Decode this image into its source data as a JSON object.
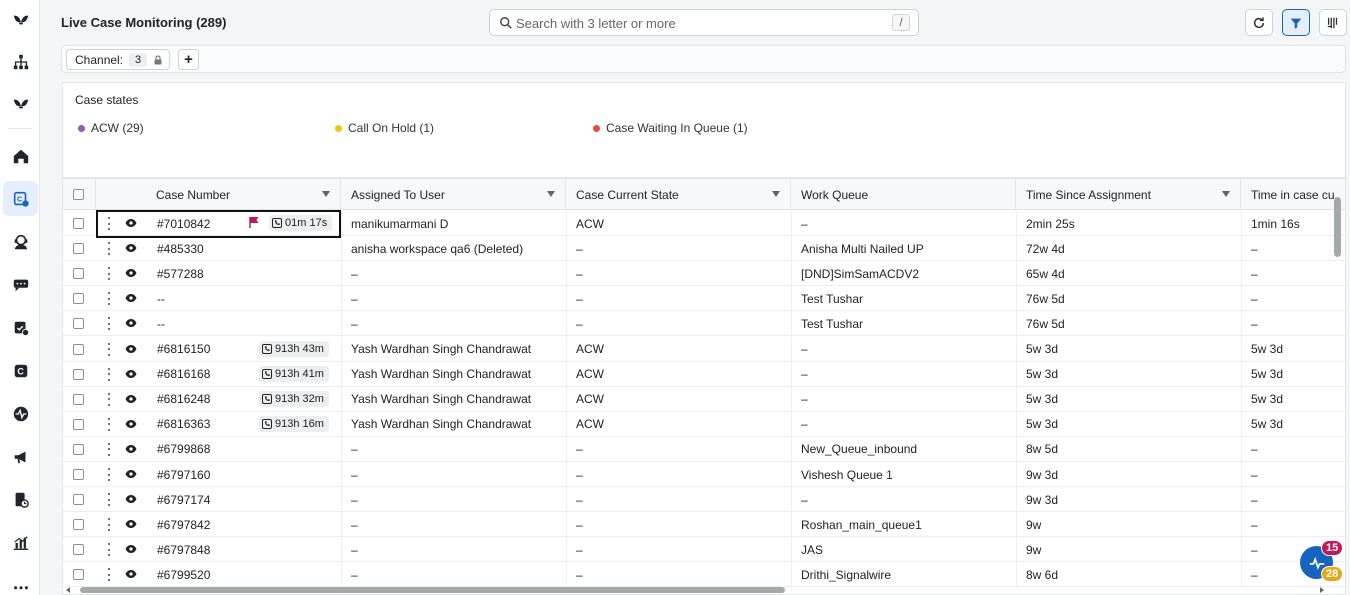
{
  "header": {
    "title": "Live Case Monitoring (289)",
    "search_placeholder": "Search with 3 letter or more",
    "search_shortcut": "/"
  },
  "filter": {
    "channel_label": "Channel:",
    "channel_count": "3",
    "add_label": "+"
  },
  "case_states": {
    "title": "Case states",
    "items": [
      {
        "label": "ACW (29)",
        "color": "#9b59b6"
      },
      {
        "label": "Call On Hold (1)",
        "color": "#f1c40f"
      },
      {
        "label": "Case Waiting In Queue (1)",
        "color": "#e74c3c"
      }
    ]
  },
  "table": {
    "columns": [
      "Case Number",
      "Assigned To User",
      "Case Current State",
      "Work Queue",
      "Time Since Assignment",
      "Time in case cu"
    ],
    "rows": [
      {
        "case": "#7010842",
        "badge": "01m 17s",
        "flag": true,
        "user": "manikumarmani D",
        "state": "ACW",
        "queue": "–",
        "since": "2min 25s",
        "incase": "1min 16s"
      },
      {
        "case": "#485330",
        "badge": "",
        "flag": false,
        "user": "anisha workspace qa6 (Deleted)",
        "state": "–",
        "queue": "Anisha Multi Nailed UP",
        "since": "72w 4d",
        "incase": "–"
      },
      {
        "case": "#577288",
        "badge": "",
        "flag": false,
        "user": "–",
        "state": "–",
        "queue": "[DND]SimSamACDV2",
        "since": "65w 4d",
        "incase": "–"
      },
      {
        "case": "--",
        "badge": "",
        "flag": false,
        "user": "–",
        "state": "–",
        "queue": "Test Tushar",
        "since": "76w 5d",
        "incase": "–"
      },
      {
        "case": "--",
        "badge": "",
        "flag": false,
        "user": "–",
        "state": "–",
        "queue": "Test Tushar",
        "since": "76w 5d",
        "incase": "–"
      },
      {
        "case": "#6816150",
        "badge": "913h 43m",
        "flag": false,
        "user": "Yash Wardhan Singh Chandrawat",
        "state": "ACW",
        "queue": "–",
        "since": "5w 3d",
        "incase": "5w 3d"
      },
      {
        "case": "#6816168",
        "badge": "913h 41m",
        "flag": false,
        "user": "Yash Wardhan Singh Chandrawat",
        "state": "ACW",
        "queue": "–",
        "since": "5w 3d",
        "incase": "5w 3d"
      },
      {
        "case": "#6816248",
        "badge": "913h 32m",
        "flag": false,
        "user": "Yash Wardhan Singh Chandrawat",
        "state": "ACW",
        "queue": "–",
        "since": "5w 3d",
        "incase": "5w 3d"
      },
      {
        "case": "#6816363",
        "badge": "913h 16m",
        "flag": false,
        "user": "Yash Wardhan Singh Chandrawat",
        "state": "ACW",
        "queue": "–",
        "since": "5w 3d",
        "incase": "5w 3d"
      },
      {
        "case": "#6799868",
        "badge": "",
        "flag": false,
        "user": "–",
        "state": "–",
        "queue": "New_Queue_inbound",
        "since": "8w 5d",
        "incase": "–"
      },
      {
        "case": "#6797160",
        "badge": "",
        "flag": false,
        "user": "–",
        "state": "–",
        "queue": "Vishesh Queue 1",
        "since": "9w 3d",
        "incase": "–"
      },
      {
        "case": "#6797174",
        "badge": "",
        "flag": false,
        "user": "–",
        "state": "–",
        "queue": "–",
        "since": "9w 3d",
        "incase": "–"
      },
      {
        "case": "#6797842",
        "badge": "",
        "flag": false,
        "user": "–",
        "state": "–",
        "queue": "Roshan_main_queue1",
        "since": "9w",
        "incase": "–"
      },
      {
        "case": "#6797848",
        "badge": "",
        "flag": false,
        "user": "–",
        "state": "–",
        "queue": "JAS",
        "since": "9w",
        "incase": "–"
      },
      {
        "case": "#6799520",
        "badge": "",
        "flag": false,
        "user": "–",
        "state": "–",
        "queue": "Drithi_Signalwire",
        "since": "8w 6d",
        "incase": "–"
      }
    ]
  },
  "widget": {
    "badge_top": "15",
    "badge_bottom": "28",
    "badge_top_color": "#c2185b",
    "badge_bottom_color": "#e6a817"
  },
  "icons": {
    "rail": [
      "logo-icon",
      "hierarchy-icon",
      "logo-icon",
      "home-icon",
      "case-monitor-icon",
      "agent-icon",
      "chat-icon",
      "case-check-icon",
      "c-icon",
      "pulse-icon",
      "megaphone-icon",
      "report-icon",
      "chart-icon",
      "more-icon"
    ]
  }
}
